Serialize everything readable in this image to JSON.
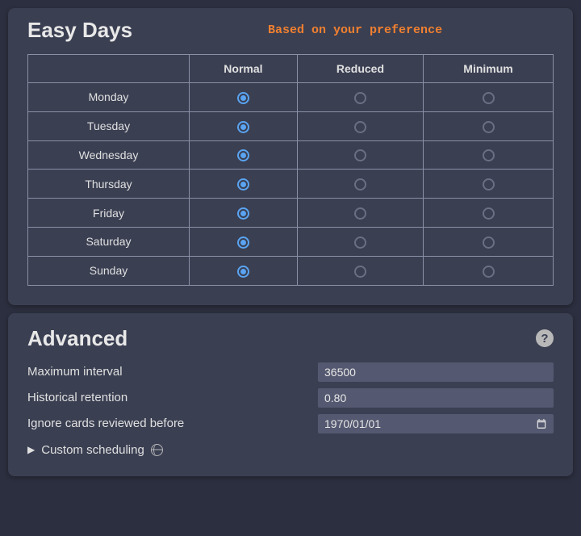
{
  "easyDays": {
    "title": "Easy Days",
    "hint": "Based on your preference",
    "columns": [
      "Normal",
      "Reduced",
      "Minimum"
    ],
    "days": [
      {
        "label": "Monday",
        "selected": 0
      },
      {
        "label": "Tuesday",
        "selected": 0
      },
      {
        "label": "Wednesday",
        "selected": 0
      },
      {
        "label": "Thursday",
        "selected": 0
      },
      {
        "label": "Friday",
        "selected": 0
      },
      {
        "label": "Saturday",
        "selected": 0
      },
      {
        "label": "Sunday",
        "selected": 0
      }
    ]
  },
  "advanced": {
    "title": "Advanced",
    "rows": {
      "maxInterval": {
        "label": "Maximum interval",
        "value": "36500"
      },
      "historicalRetention": {
        "label": "Historical retention",
        "value": "0.80"
      },
      "ignoreBefore": {
        "label": "Ignore cards reviewed before",
        "value": "1970/01/01"
      }
    },
    "customScheduling": "Custom scheduling"
  }
}
